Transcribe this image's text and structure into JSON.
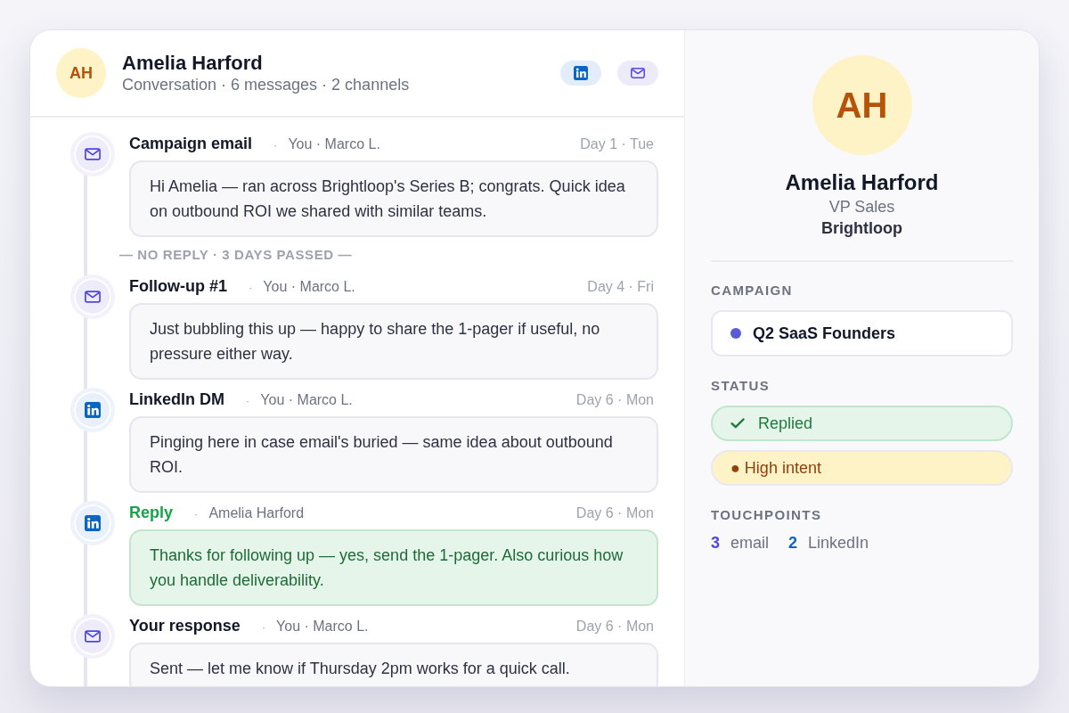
{
  "contact": {
    "initials": "AH",
    "name": "Amelia Harford",
    "summary": "Conversation · 6 messages · 2 channels"
  },
  "channels": [
    {
      "kind": "linkedin"
    },
    {
      "kind": "email"
    }
  ],
  "thread": [
    {
      "kind": "message",
      "channel": {
        "kind": "email"
      },
      "title": "Campaign email",
      "separator": "·",
      "meta": "You · Marco L.",
      "date": "Day 1 · Tue",
      "body": "Hi Amelia — ran across Brightloop's Series B; congrats. Quick idea on outbound ROI we shared with similar teams."
    },
    {
      "kind": "gap",
      "label": "— NO REPLY · 3 DAYS PASSED —"
    },
    {
      "kind": "message",
      "channel": {
        "kind": "email"
      },
      "title": "Follow-up #1",
      "separator": "·",
      "meta": "You · Marco L.",
      "date": "Day 4 · Fri",
      "body": "Just bubbling this up — happy to share the 1-pager if useful, no pressure either way."
    },
    {
      "kind": "message",
      "channel": {
        "kind": "linkedin"
      },
      "title": "LinkedIn DM",
      "separator": "·",
      "meta": "You · Marco L.",
      "date": "Day 6 · Mon",
      "body": "Pinging here in case email's buried — same idea about outbound ROI."
    },
    {
      "kind": "reply",
      "channel": {
        "kind": "linkedin"
      },
      "title": "Reply",
      "separator": "·",
      "meta": "Amelia Harford",
      "date": "Day 6 · Mon",
      "body": "Thanks for following up — yes, send the 1-pager. Also curious how you handle deliverability."
    },
    {
      "kind": "message",
      "channel": {
        "kind": "email"
      },
      "title": "Your response",
      "separator": "·",
      "meta": "You · Marco L.",
      "date": "Day 6 · Mon",
      "body": "Sent — let me know if Thursday 2pm works for a quick call."
    }
  ],
  "profile": {
    "initials": "AH",
    "name": "Amelia Harford",
    "role": "VP Sales",
    "company": "Brightloop"
  },
  "campaign": {
    "label": "CAMPAIGN",
    "name": "Q2 SaaS Founders",
    "color": "#5b5bd6"
  },
  "status": {
    "label": "STATUS",
    "pills": [
      {
        "kind": "replied",
        "text": "Replied"
      },
      {
        "kind": "intent",
        "text": "● High intent"
      }
    ]
  },
  "touchpoints": {
    "label": "TOUCHPOINTS",
    "items": [
      {
        "count": "3",
        "label": "email",
        "color": "#4f46e5"
      },
      {
        "count": "2",
        "label": "LinkedIn",
        "color": "#0a66c2"
      }
    ]
  }
}
